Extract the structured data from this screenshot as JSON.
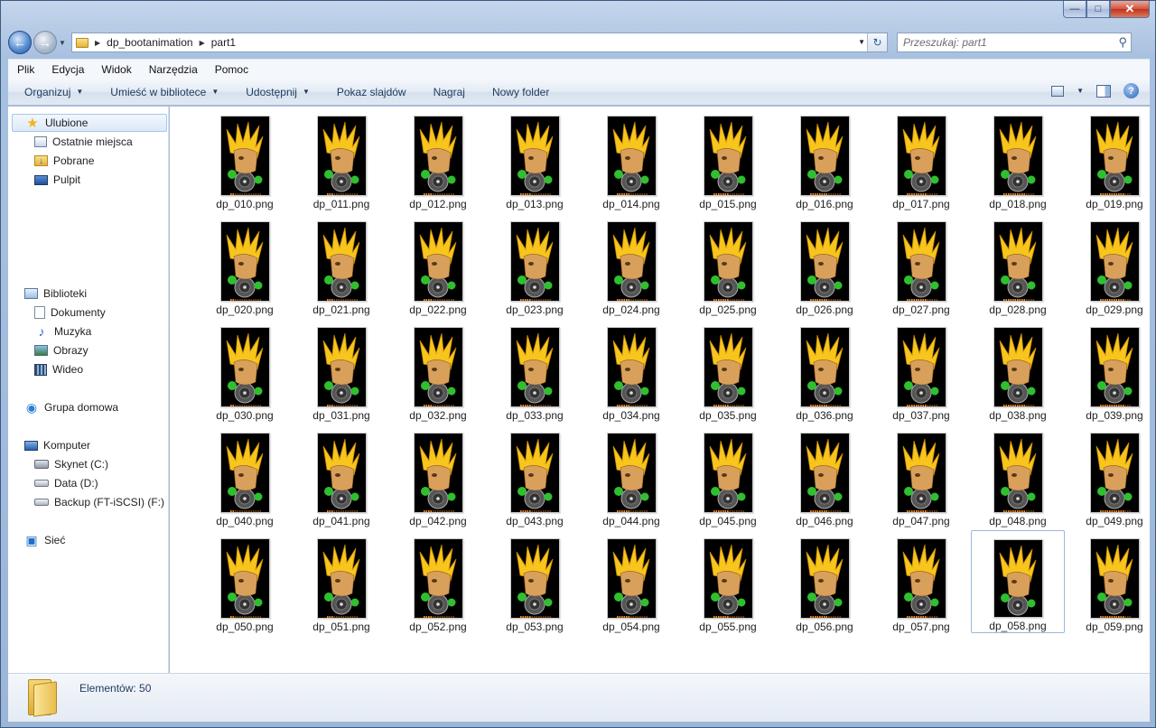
{
  "window": {
    "caption_buttons": {
      "minimize": "—",
      "maximize": "□",
      "close": "✕"
    }
  },
  "address": {
    "crumbs": [
      "dp_bootanimation",
      "part1"
    ],
    "search_placeholder": "Przeszukaj: part1"
  },
  "menu": [
    "Plik",
    "Edycja",
    "Widok",
    "Narzędzia",
    "Pomoc"
  ],
  "commands": [
    {
      "label": "Organizuj",
      "dropdown": true
    },
    {
      "label": "Umieść w bibliotece",
      "dropdown": true
    },
    {
      "label": "Udostępnij",
      "dropdown": true
    },
    {
      "label": "Pokaz slajdów",
      "dropdown": false
    },
    {
      "label": "Nagraj",
      "dropdown": false
    },
    {
      "label": "Nowy folder",
      "dropdown": false
    }
  ],
  "nav": {
    "favorites": "Ulubione",
    "recent": "Ostatnie miejsca",
    "downloads": "Pobrane",
    "desktop": "Pulpit",
    "libraries": "Biblioteki",
    "documents": "Dokumenty",
    "music": "Muzyka",
    "pictures": "Obrazy",
    "videos": "Wideo",
    "homegroup": "Grupa domowa",
    "computer": "Komputer",
    "drive_c": "Skynet (C:)",
    "drive_d": "Data (D:)",
    "drive_f": "Backup (FT-iSCSI) (F:)",
    "network": "Sieć"
  },
  "files": [
    "dp_010.png",
    "dp_011.png",
    "dp_012.png",
    "dp_013.png",
    "dp_014.png",
    "dp_015.png",
    "dp_016.png",
    "dp_017.png",
    "dp_018.png",
    "dp_019.png",
    "dp_020.png",
    "dp_021.png",
    "dp_022.png",
    "dp_023.png",
    "dp_024.png",
    "dp_025.png",
    "dp_026.png",
    "dp_027.png",
    "dp_028.png",
    "dp_029.png",
    "dp_030.png",
    "dp_031.png",
    "dp_032.png",
    "dp_033.png",
    "dp_034.png",
    "dp_035.png",
    "dp_036.png",
    "dp_037.png",
    "dp_038.png",
    "dp_039.png",
    "dp_040.png",
    "dp_041.png",
    "dp_042.png",
    "dp_043.png",
    "dp_044.png",
    "dp_045.png",
    "dp_046.png",
    "dp_047.png",
    "dp_048.png",
    "dp_049.png",
    "dp_050.png",
    "dp_051.png",
    "dp_052.png",
    "dp_053.png",
    "dp_054.png",
    "dp_055.png",
    "dp_056.png",
    "dp_057.png",
    "dp_058.png",
    "dp_059.png"
  ],
  "selected_file": "dp_058.png",
  "status": {
    "count": "Elementów: 50"
  },
  "icons": {
    "back": "back-arrow-icon",
    "forward": "forward-arrow-icon",
    "refresh": "refresh-icon",
    "search": "search-icon",
    "help": "help-icon"
  },
  "colors": {
    "accent": "#1e395b",
    "selection_border": "#99b8e0",
    "frame": "#a9c1e0"
  }
}
